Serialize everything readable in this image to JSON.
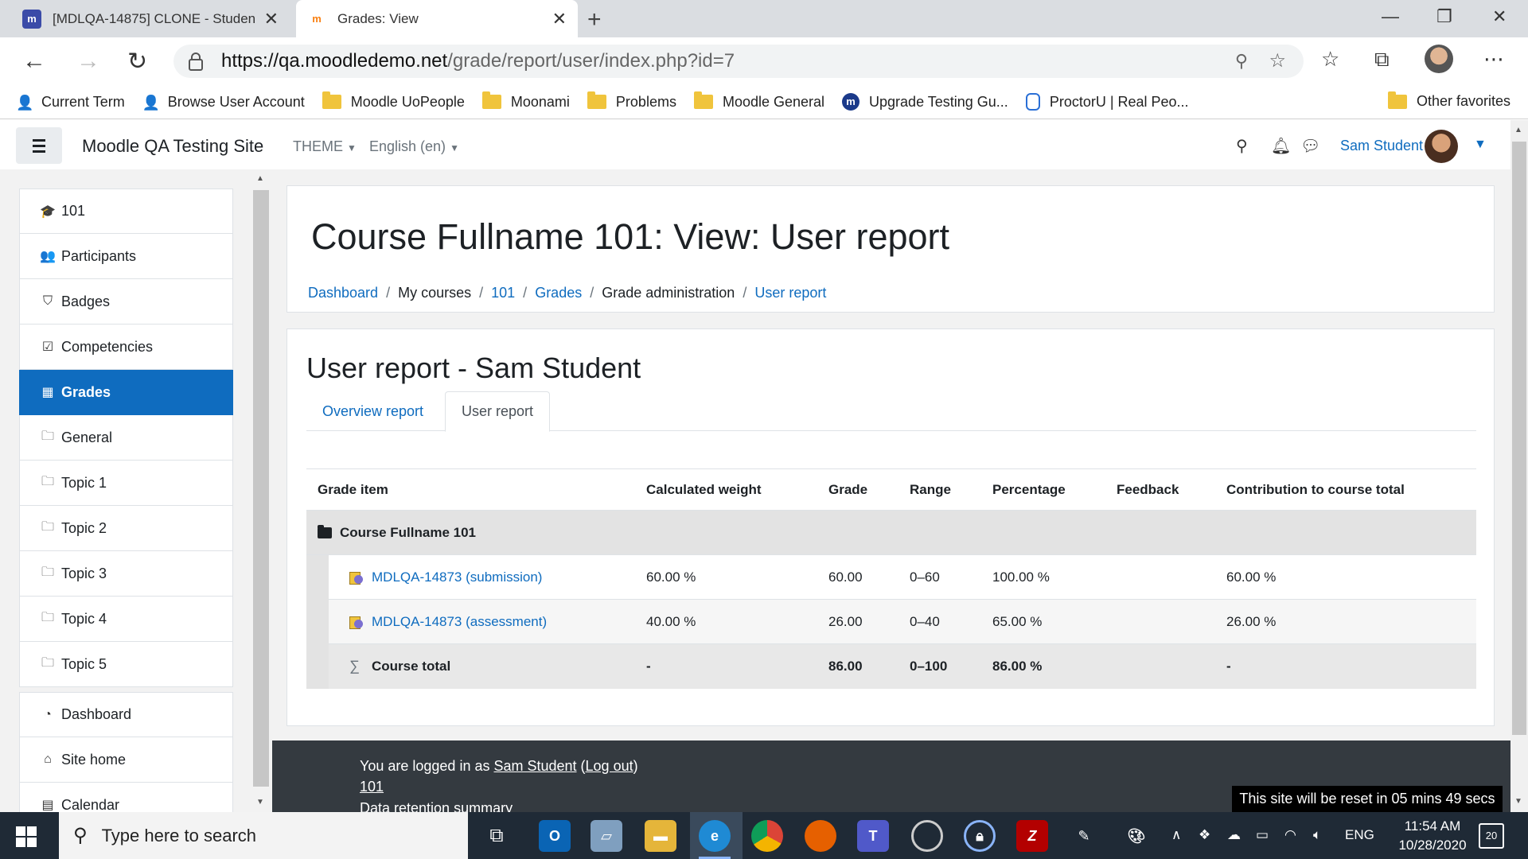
{
  "browser": {
    "tabs": [
      {
        "title": "[MDLQA-14875] CLONE - Studen",
        "favicon": "moodle-tracker-icon",
        "color": "#3b4ba8"
      },
      {
        "title": "Grades: View",
        "favicon": "moodle-icon",
        "color": "#f98012"
      }
    ],
    "url_domain": "https://qa.moodledemo.net",
    "url_path": "/grade/report/user/index.php?id=7",
    "bookmarks": [
      {
        "label": "Current Term",
        "icon": "user-icon"
      },
      {
        "label": "Browse User Account",
        "icon": "user-icon"
      },
      {
        "label": "Moodle UoPeople",
        "icon": "folder-icon"
      },
      {
        "label": "Moonami",
        "icon": "folder-icon"
      },
      {
        "label": "Problems",
        "icon": "folder-icon"
      },
      {
        "label": "Moodle General",
        "icon": "folder-icon"
      },
      {
        "label": "Upgrade Testing Gu...",
        "icon": "moodle-icon"
      },
      {
        "label": "ProctorU | Real Peo...",
        "icon": "owl-icon"
      }
    ],
    "other_favorites": "Other favorites"
  },
  "navbar": {
    "site_name": "Moodle QA Testing Site",
    "theme_label": "THEME",
    "language_label": "English (en)",
    "user_name": "Sam Student"
  },
  "drawer": {
    "course_items": [
      {
        "label": "101",
        "icon": "graduation-cap-icon",
        "glyph": "🎓"
      },
      {
        "label": "Participants",
        "icon": "users-icon",
        "glyph": "👥"
      },
      {
        "label": "Badges",
        "icon": "shield-icon",
        "glyph": "⛉"
      },
      {
        "label": "Competencies",
        "icon": "check-square-icon",
        "glyph": "☑"
      },
      {
        "label": "Grades",
        "icon": "table-icon",
        "glyph": "▦",
        "active": true
      },
      {
        "label": "General",
        "icon": "folder-icon",
        "glyph": "🗀"
      },
      {
        "label": "Topic 1",
        "icon": "folder-icon",
        "glyph": "🗀"
      },
      {
        "label": "Topic 2",
        "icon": "folder-icon",
        "glyph": "🗀"
      },
      {
        "label": "Topic 3",
        "icon": "folder-icon",
        "glyph": "🗀"
      },
      {
        "label": "Topic 4",
        "icon": "folder-icon",
        "glyph": "🗀"
      },
      {
        "label": "Topic 5",
        "icon": "folder-icon",
        "glyph": "🗀"
      }
    ],
    "site_items": [
      {
        "label": "Dashboard",
        "icon": "dashboard-icon",
        "glyph": "◔"
      },
      {
        "label": "Site home",
        "icon": "home-icon",
        "glyph": "⌂"
      },
      {
        "label": "Calendar",
        "icon": "calendar-icon",
        "glyph": "▤"
      }
    ]
  },
  "header": {
    "title": "Course Fullname 101: View: User report",
    "breadcrumb": [
      {
        "label": "Dashboard",
        "link": true
      },
      {
        "label": "My courses",
        "link": false
      },
      {
        "label": "101",
        "link": true
      },
      {
        "label": "Grades",
        "link": true
      },
      {
        "label": "Grade administration",
        "link": false
      },
      {
        "label": "User report",
        "link": true
      }
    ]
  },
  "report": {
    "title": "User report - Sam Student",
    "tabs": [
      "Overview report",
      "User report"
    ],
    "columns": [
      "Grade item",
      "Calculated weight",
      "Grade",
      "Range",
      "Percentage",
      "Feedback",
      "Contribution to course total"
    ],
    "category": "Course Fullname 101",
    "rows": [
      {
        "item": "MDLQA-14873 (submission)",
        "weight": "60.00 %",
        "grade": "60.00",
        "range": "0–60",
        "percentage": "100.00 %",
        "feedback": "",
        "contribution": "60.00 %"
      },
      {
        "item": "MDLQA-14873 (assessment)",
        "weight": "40.00 %",
        "grade": "26.00",
        "range": "0–40",
        "percentage": "65.00 %",
        "feedback": "",
        "contribution": "26.00 %"
      }
    ],
    "total": {
      "item": "Course total",
      "weight": "-",
      "grade": "86.00",
      "range": "0–100",
      "percentage": "86.00 %",
      "feedback": "",
      "contribution": "-"
    }
  },
  "footer": {
    "logged_in_prefix": "You are logged in as ",
    "user_link": "Sam Student",
    "logout_open": " (",
    "logout_link": "Log out",
    "logout_close": ")",
    "course_link": "101",
    "data_retention": "Data retention summary"
  },
  "reset_banner": "This site will be reset in 05 mins 49 secs",
  "taskbar": {
    "search_placeholder": "Type here to search",
    "language": "ENG",
    "time": "11:54 AM",
    "date": "10/28/2020",
    "notification_count": "20"
  }
}
